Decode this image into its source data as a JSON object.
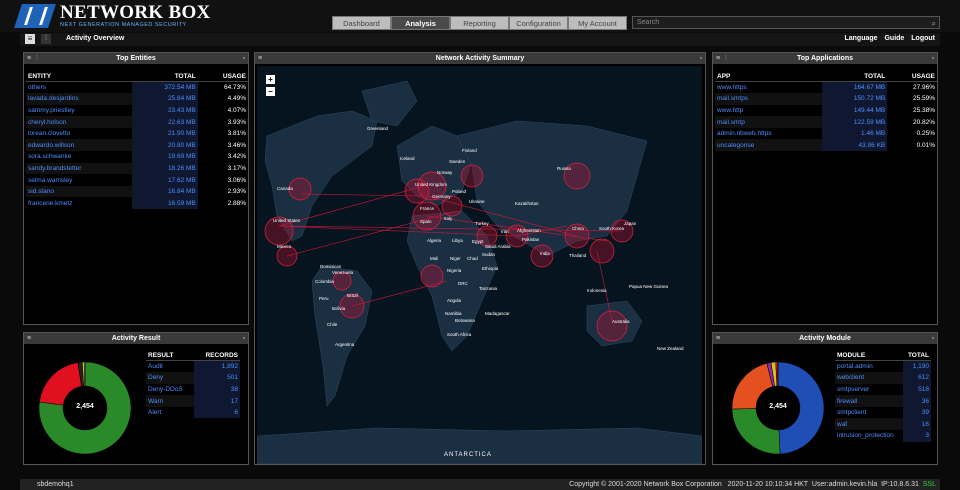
{
  "brand": {
    "title": "NETWORK BOX",
    "subtitle": "NEXT GENERATION MANAGED SECURITY"
  },
  "tabs": [
    "Dashboard",
    "Analysis",
    "Reporting",
    "Configuration",
    "My Account"
  ],
  "active_tab": "Analysis",
  "search": {
    "placeholder": "Search"
  },
  "subbar": {
    "title": "Activity Overview",
    "links": [
      "Language",
      "Guide",
      "Logout"
    ]
  },
  "top_entities": {
    "title": "Top Entities",
    "headers": [
      "ENTITY",
      "TOTAL",
      "USAGE"
    ],
    "rows": [
      [
        "others",
        "372.54 MB",
        "64.73%"
      ],
      [
        "lavada.desjardins",
        "25.84 MB",
        "4.49%"
      ],
      [
        "sammy.priestley",
        "23.43 MB",
        "4.07%"
      ],
      [
        "cheryl.holson",
        "22.63 MB",
        "3.93%"
      ],
      [
        "lorean.clovetto",
        "21.90 MB",
        "3.81%"
      ],
      [
        "edwardo.willson",
        "20.80 MB",
        "3.46%"
      ],
      [
        "sora.schwanke",
        "19.69 MB",
        "3.42%"
      ],
      [
        "sandy.brandstetter",
        "18.26 MB",
        "3.17%"
      ],
      [
        "selma.wamsley",
        "17.62 MB",
        "3.06%"
      ],
      [
        "sid.stano",
        "16.84 MB",
        "2.93%"
      ],
      [
        "francene.kmetz",
        "16.59 MB",
        "2.88%"
      ]
    ]
  },
  "top_apps": {
    "title": "Top Applications",
    "headers": [
      "APP",
      "TOTAL",
      "USAGE"
    ],
    "rows": [
      [
        "www.https",
        "164.67 MB",
        "27.96%"
      ],
      [
        "mail.smtps",
        "150.72 MB",
        "25.59%"
      ],
      [
        "www.http",
        "149.44 MB",
        "25.38%"
      ],
      [
        "mail.smtp",
        "122.59 MB",
        "20.82%"
      ],
      [
        "admin.nbweb.https",
        "1.46 MB",
        "0.25%"
      ],
      [
        "uncategorise",
        "43.96 KB",
        "0.01%"
      ]
    ]
  },
  "network": {
    "title": "Network Activity Summary",
    "labels": [
      "Greenland",
      "Iceland",
      "Finland",
      "Sweden",
      "Norway",
      "Russia",
      "United Kingdom",
      "Poland",
      "Germany",
      "Ukraine",
      "France",
      "Spain",
      "Italy",
      "Turkey",
      "Kazakhstan",
      "Canada",
      "United States",
      "Mexico",
      "Algeria",
      "Libya",
      "Egypt",
      "Iran",
      "Afghanistan",
      "Pakistan",
      "India",
      "China",
      "South Korea",
      "Japan",
      "Thailand",
      "Mali",
      "Niger",
      "Chad",
      "Sudan",
      "Ethiopia",
      "Nigeria",
      "Saudi Arabia",
      "DRC",
      "Tanzania",
      "Angola",
      "Namibia",
      "Botswana",
      "Madagascar",
      "South Africa",
      "Colombia",
      "Venezuela",
      "Dominican",
      "Peru",
      "Brazil",
      "Bolivia",
      "Chile",
      "Argentina",
      "Indonesia",
      "Papua New Guinea",
      "Australia",
      "New Zealand",
      "ANTARCTICA"
    ],
    "zoom_in": "+",
    "zoom_out": "−"
  },
  "activity_result": {
    "title": "Activity Result",
    "total": "2,454",
    "headers": [
      "RESULT",
      "RECORDS"
    ],
    "rows": [
      [
        "Audit",
        "1,892"
      ],
      [
        "Deny",
        "501"
      ],
      [
        "Deny-DDoS",
        "38"
      ],
      [
        "Warn",
        "17"
      ],
      [
        "Alert",
        "6"
      ]
    ],
    "colors": [
      "#2a8a2a",
      "#e01020",
      "#222222",
      "#d8c020",
      "#ffffff"
    ]
  },
  "activity_module": {
    "title": "Activity Module",
    "total": "2,454",
    "headers": [
      "MODULE",
      "TOTAL"
    ],
    "rows": [
      [
        "portal.admin",
        "1,190"
      ],
      [
        "webclient",
        "612"
      ],
      [
        "smtpserver",
        "518"
      ],
      [
        "firewall",
        "36"
      ],
      [
        "smtpclient",
        "39"
      ],
      [
        "waf",
        "16"
      ],
      [
        "intrusion_protection",
        "3"
      ]
    ],
    "colors": [
      "#1f4fb5",
      "#2a8a2a",
      "#e55020",
      "#8a2aa0",
      "#d8c020",
      "#e01020",
      "#ffffff"
    ]
  },
  "footer": {
    "host": "sbdemohq1",
    "copyright": "Copyright © 2001-2020 Network Box Corporation",
    "datetime": "2020-11-20 10:10:34 HKT",
    "user": "User:admin.kevin.hla",
    "ip": "IP:10.8.6.31",
    "ssl": "SSL"
  }
}
